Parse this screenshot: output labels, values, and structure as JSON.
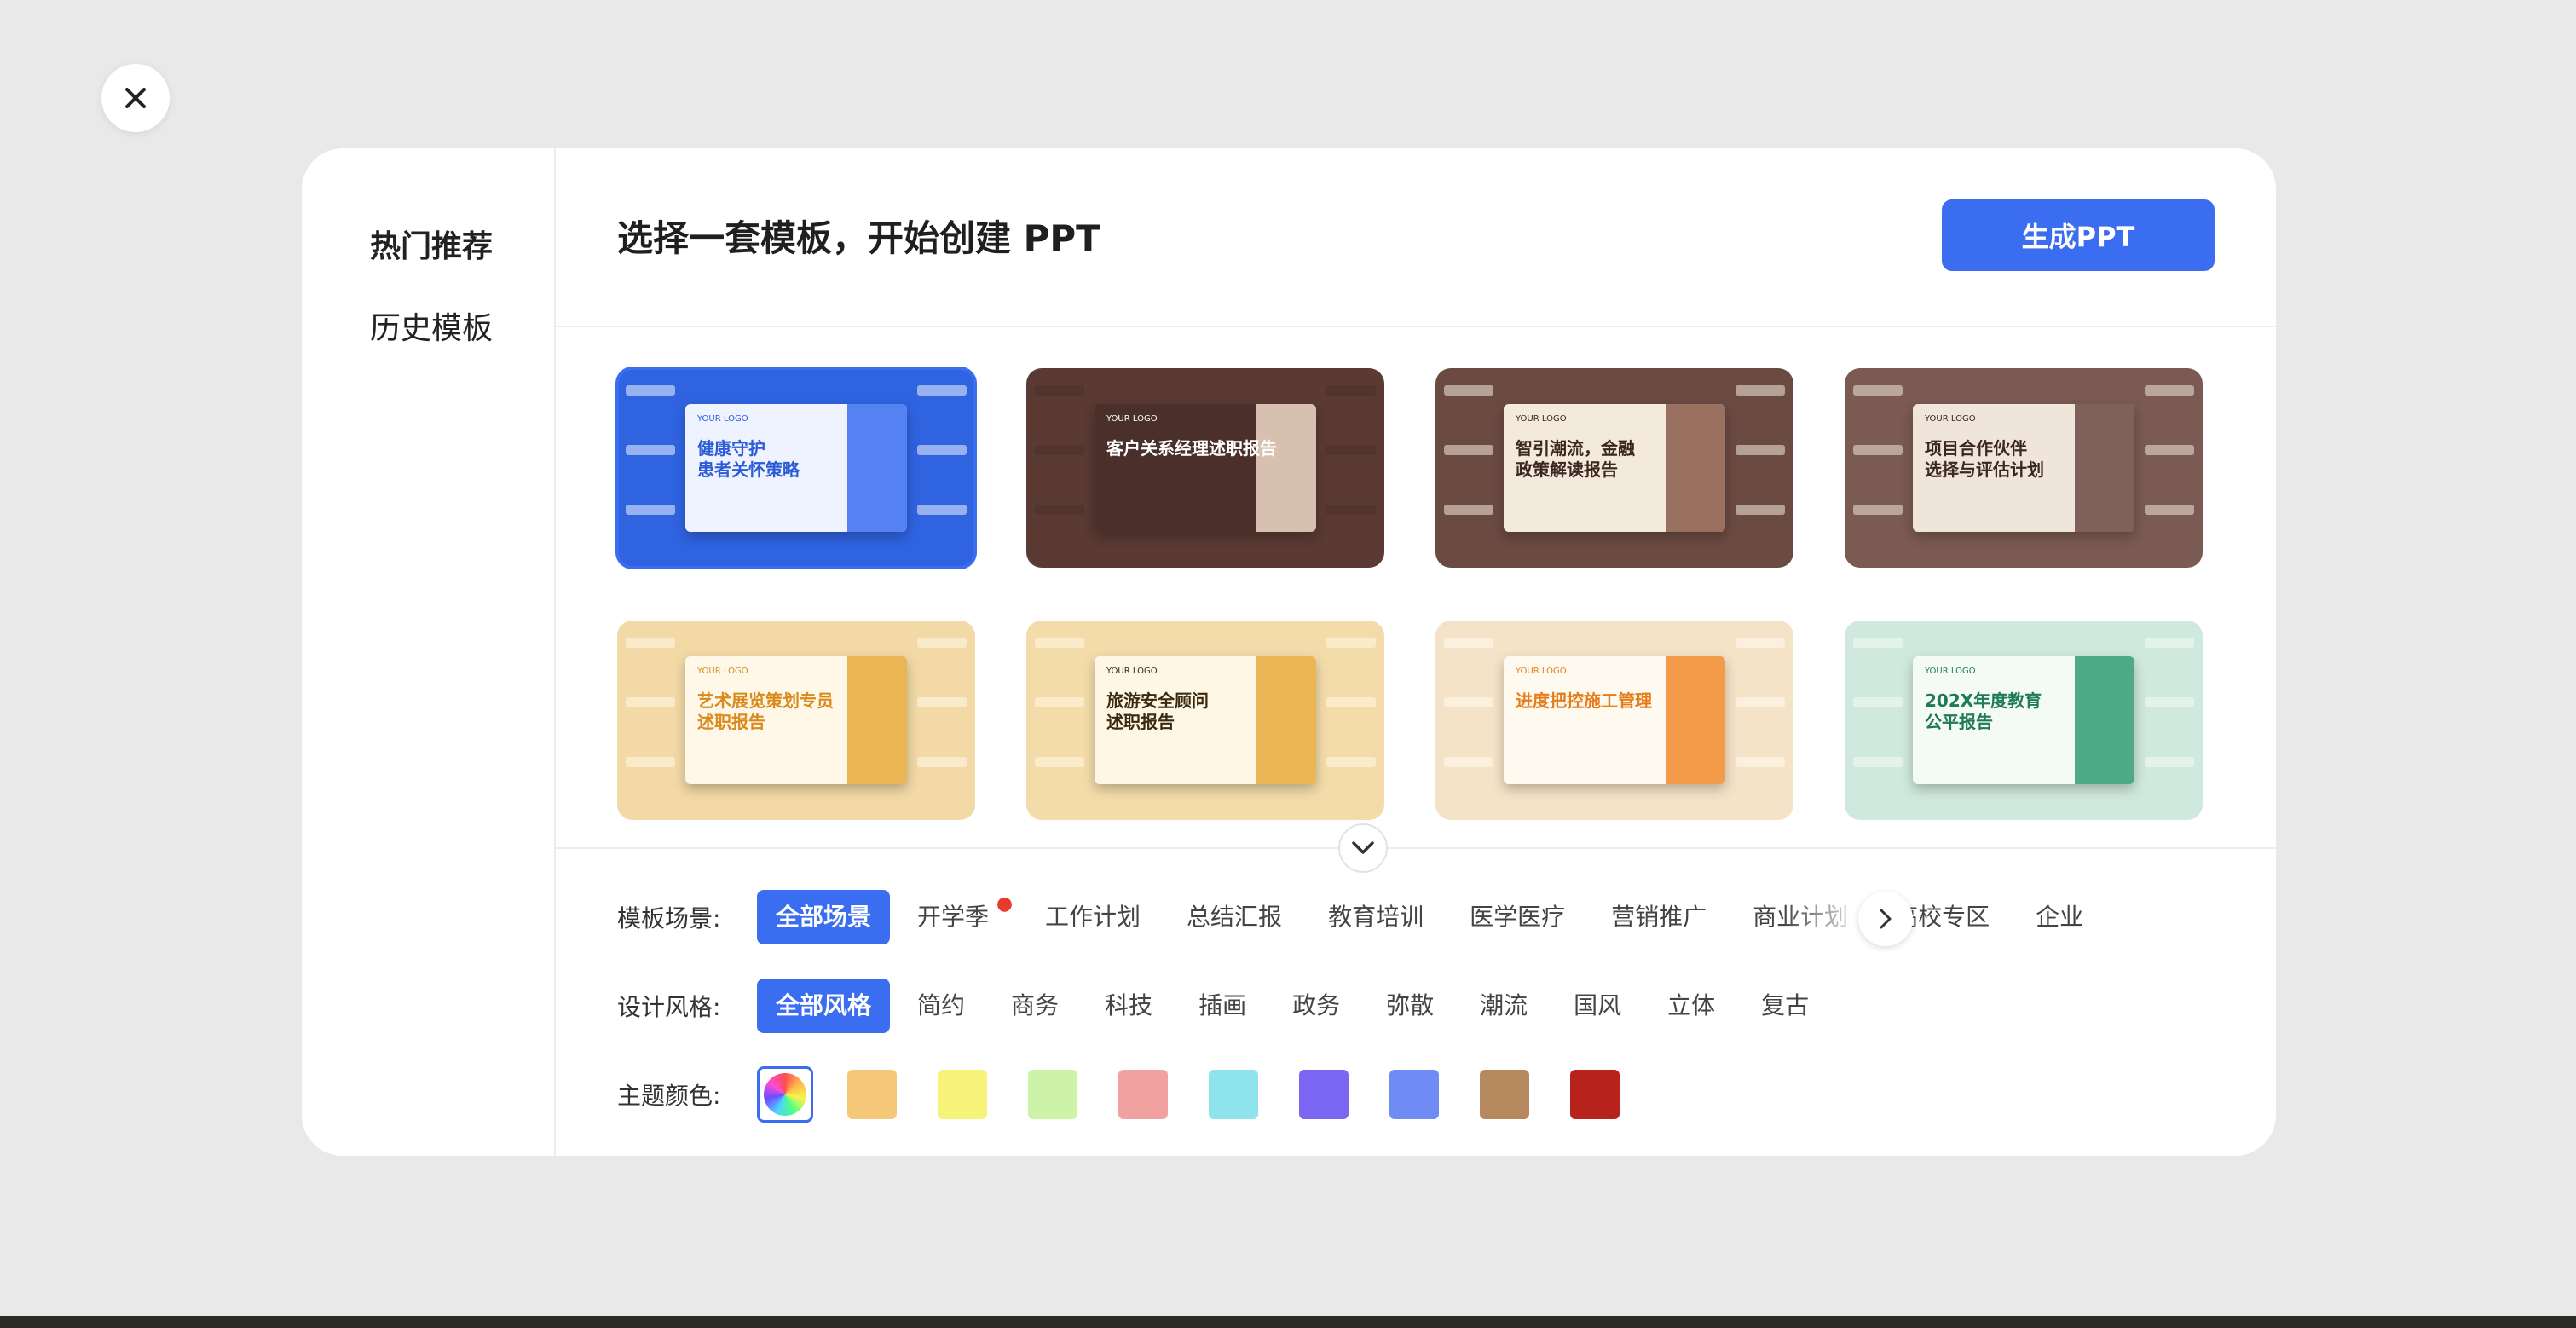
{
  "sidebar": {
    "items": [
      {
        "label": "热门推荐"
      },
      {
        "label": "历史模板"
      }
    ]
  },
  "header": {
    "title": "选择一套模板，开始创建 PPT",
    "generate_label": "生成PPT"
  },
  "templates": [
    {
      "title": "健康守护\n患者关怀策略",
      "logo": "YOUR LOGO",
      "bg": "#2f63e0",
      "slide_bg": "#eef3ff",
      "accent": "#3a6df0",
      "text_color": "#2b5bd8"
    },
    {
      "title": "客户关系经理述职报告",
      "logo": "YOUR LOGO",
      "bg": "#5a3a33",
      "slide_bg": "#4a2f2a",
      "accent": "#f0d9c8",
      "text_color": "#ffffff"
    },
    {
      "title": "智引潮流，金融\n政策解读报告",
      "logo": "YOUR LOGO",
      "bg": "#6b4a42",
      "slide_bg": "#f3eadc",
      "accent": "#8a5a4a",
      "text_color": "#3b2620"
    },
    {
      "title": "项目合作伙伴\n选择与评估计划",
      "logo": "YOUR LOGO",
      "bg": "#7a5a52",
      "slide_bg": "#efe5da",
      "accent": "#6b4a42",
      "text_color": "#3b2620"
    },
    {
      "title": "艺术展览策划专员\n述职报告",
      "logo": "YOUR LOGO",
      "bg": "#f2d9a6",
      "slide_bg": "#fff8e8",
      "accent": "#e7a93a",
      "text_color": "#d98a1a"
    },
    {
      "title": "旅游安全顾问\n述职报告",
      "logo": "YOUR LOGO",
      "bg": "#f4dcaa",
      "slide_bg": "#fff7e6",
      "accent": "#e9a93c",
      "text_color": "#3b2a10"
    },
    {
      "title": "进度把控施工管理",
      "logo": "YOUR LOGO",
      "bg": "#f5e3c8",
      "slide_bg": "#fffaf0",
      "accent": "#f28a2c",
      "text_color": "#e67d1c"
    },
    {
      "title": "202X年度教育\n公平报告",
      "logo": "YOUR LOGO",
      "bg": "#cfe9de",
      "slide_bg": "#f4fbf7",
      "accent": "#2f9a72",
      "text_color": "#1f7a58"
    }
  ],
  "filters": {
    "scene": {
      "label": "模板场景:",
      "options": [
        "全部场景",
        "开学季",
        "工作计划",
        "总结汇报",
        "教育培训",
        "医学医疗",
        "营销推广",
        "商业计划",
        "高校专区",
        "企业"
      ]
    },
    "style": {
      "label": "设计风格:",
      "options": [
        "全部风格",
        "简约",
        "商务",
        "科技",
        "插画",
        "政务",
        "弥散",
        "潮流",
        "国风",
        "立体",
        "复古"
      ]
    },
    "color": {
      "label": "主题颜色:",
      "swatches": [
        "rainbow",
        "#f4c878",
        "#f7f27a",
        "#cdf3a8",
        "#f2a1a1",
        "#8ee3ec",
        "#7a66f2",
        "#6f8bf4",
        "#b68a5e",
        "#b8221c"
      ]
    }
  },
  "icons": {
    "close": "close-icon",
    "expand": "chevron-down-icon",
    "scroll": "chevron-right-icon",
    "hot": "fire-icon"
  }
}
